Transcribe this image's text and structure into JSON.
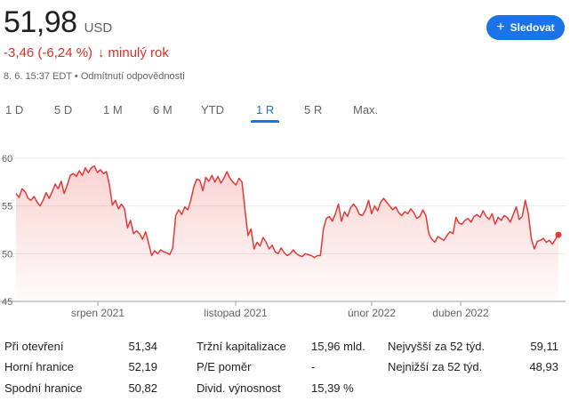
{
  "quote": {
    "price": "51,98",
    "currency": "USD",
    "change": "-3,46 (-6,24 %)",
    "change_arrow": "↓",
    "period": "minulý rok",
    "timestamp": "8. 6. 15:37 EDT",
    "disclaimer": "Odmítnutí odpovědnosti",
    "separator": "•",
    "negative_color": "#d93025"
  },
  "follow_button": {
    "plus": "+",
    "label": "Sledovat",
    "color": "#1a73e8"
  },
  "tabs": [
    {
      "label": "1 D",
      "active": false
    },
    {
      "label": "5 D",
      "active": false
    },
    {
      "label": "1 M",
      "active": false
    },
    {
      "label": "6 M",
      "active": false
    },
    {
      "label": "YTD",
      "active": false
    },
    {
      "label": "1 R",
      "active": true
    },
    {
      "label": "5 R",
      "active": false
    },
    {
      "label": "Max.",
      "active": false
    }
  ],
  "chart_data": {
    "type": "area",
    "series": [
      {
        "values": [
          56.3,
          55.9,
          56.8,
          56.5,
          55.8,
          55.6,
          56.0,
          55.4,
          55.0,
          55.6,
          56.4,
          55.8,
          56.5,
          57.3,
          56.8,
          57.6,
          56.3,
          57.2,
          58.2,
          58.4,
          58.1,
          58.7,
          58.2,
          59.0,
          58.5,
          59.0,
          59.2,
          58.5,
          58.8,
          58.4,
          58.6,
          57.2,
          55.1,
          55.6,
          54.7,
          55.2,
          54.7,
          52.7,
          53.5,
          52.1,
          52.4,
          52.1,
          51.5,
          52.3,
          51.1,
          49.8,
          50.3,
          50.0,
          50.4,
          50.2,
          50.1,
          49.9,
          50.6,
          54.0,
          54.6,
          54.1,
          54.9,
          54.6,
          55.6,
          57.0,
          57.8,
          57.7,
          56.6,
          58.0,
          57.6,
          58.2,
          57.5,
          58.1,
          57.4,
          57.9,
          58.6,
          57.9,
          57.5,
          57.2,
          57.9,
          57.5,
          54.5,
          51.9,
          52.6,
          50.5,
          51.2,
          50.8,
          51.7,
          51.2,
          50.5,
          50.9,
          50.2,
          50.0,
          50.6,
          50.1,
          49.8,
          50.0,
          50.4,
          50.0,
          49.8,
          49.7,
          50.0,
          49.9,
          49.8,
          49.6,
          49.8,
          49.8,
          52.6,
          53.7,
          53.9,
          53.4,
          54.2,
          55.2,
          53.4,
          54.4,
          53.9,
          54.8,
          55.2,
          54.8,
          54.1,
          54.0,
          54.6,
          55.6,
          54.2,
          55.0,
          54.5,
          55.4,
          55.8,
          55.4,
          55.0,
          54.6,
          54.9,
          54.3,
          54.0,
          54.4,
          54.2,
          54.7,
          54.3,
          53.7,
          53.9,
          54.6,
          54.0,
          52.1,
          51.5,
          51.2,
          51.8,
          51.6,
          51.4,
          51.9,
          52.3,
          52.1,
          53.8,
          53.2,
          53.1,
          53.5,
          53.7,
          53.3,
          53.9,
          54.1,
          53.8,
          54.5,
          53.9,
          53.6,
          54.2,
          53.1,
          53.8,
          53.5,
          54.0,
          53.8,
          53.3,
          54.1,
          54.9,
          53.6,
          53.9,
          55.6,
          54.2,
          51.6,
          50.5,
          51.3,
          51.4,
          51.6,
          51.2,
          51.4,
          51.0,
          51.5,
          51.98
        ],
        "last_value": 51.98
      }
    ],
    "x_tick_labels": [
      "srpen 2021",
      "listopad 2021",
      "únor 2022",
      "duben 2022"
    ],
    "y_ticks": [
      45,
      50,
      55,
      60
    ],
    "ylim": [
      45,
      60
    ],
    "grid": true,
    "line_color": "#e53935"
  },
  "stats": {
    "col1": [
      {
        "label": "Při otevření",
        "value": "51,34"
      },
      {
        "label": "Horní hranice",
        "value": "52,19"
      },
      {
        "label": "Spodní hranice",
        "value": "50,82"
      }
    ],
    "col2": [
      {
        "label": "Tržní kapitalizace",
        "value": "15,96 mld."
      },
      {
        "label": "P/E poměr",
        "value": "-"
      },
      {
        "label": "Divid. výnosnost",
        "value": "15,39 %"
      }
    ],
    "col3": [
      {
        "label": "Nejvyšší za 52 týd.",
        "value": "59,11"
      },
      {
        "label": "Nejnižší za 52 týd.",
        "value": "48,93"
      }
    ]
  }
}
